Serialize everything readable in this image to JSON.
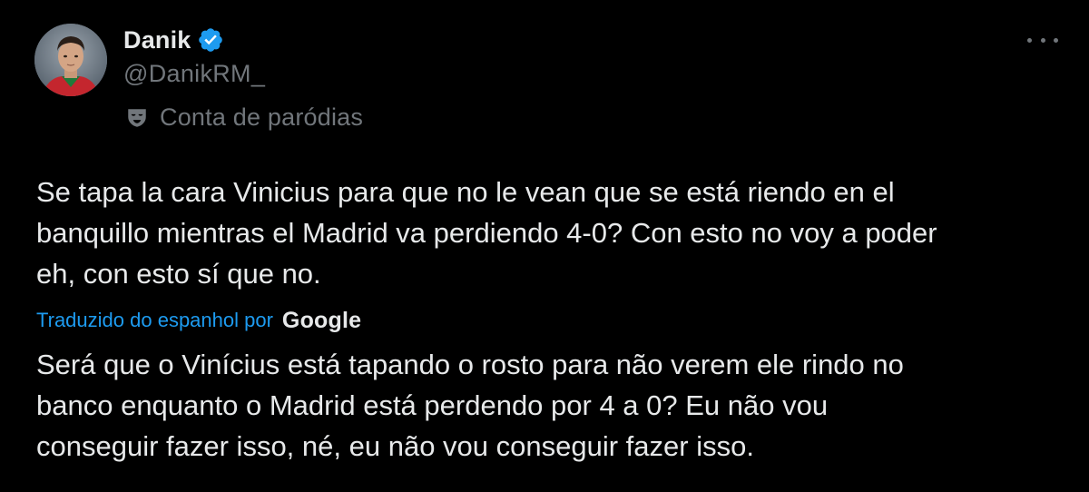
{
  "author": {
    "display_name": "Danik",
    "handle": "@DanikRM_",
    "verified": true,
    "verified_color": "#1d9bf0",
    "avatar_icon": "profile-photo"
  },
  "parody_label": "Conta de paródias",
  "parody_icon": "parody-mask-icon",
  "more_icon": "more-horizontal-icon",
  "tweet": {
    "text": "Se tapa la cara Vinicius para que no le vean que se está riendo en el\nbanquillo mientras el Madrid va perdiendo 4-0? Con esto no voy a poder\neh, con esto sí que no."
  },
  "translation": {
    "label": "Traduzido do espanhol por",
    "provider": "Google",
    "text": "Será que o Vinícius está tapando o rosto para não verem ele rindo no\nbanco enquanto o Madrid está perdendo por 4 a 0? Eu não vou\nconseguir fazer isso, né, eu não vou conseguir fazer isso."
  },
  "colors": {
    "background": "#000000",
    "primary_text": "#e7e9ea",
    "secondary_text": "#71767b",
    "link": "#1d9bf0"
  }
}
